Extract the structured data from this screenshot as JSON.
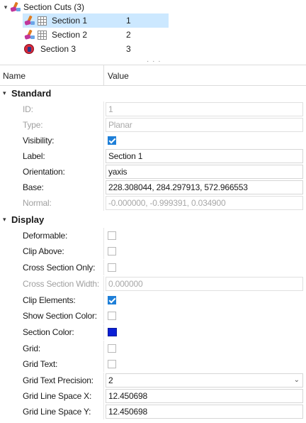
{
  "tree": {
    "parent_label": "Section Cuts (3)",
    "items": [
      {
        "label": "Section 1",
        "id": "1"
      },
      {
        "label": "Section 2",
        "id": "2"
      },
      {
        "label": "Section 3",
        "id": "3"
      }
    ],
    "splitter": "· · ·"
  },
  "grid_header": {
    "name": "Name",
    "value": "Value"
  },
  "standard": {
    "title": "Standard",
    "id_label": "ID:",
    "id_value": "1",
    "type_label": "Type:",
    "type_value": "Planar",
    "visibility_label": "Visibility:",
    "visibility_checked": true,
    "label_label": "Label:",
    "label_value": "Section 1",
    "orientation_label": "Orientation:",
    "orientation_value": "yaxis",
    "base_label": "Base:",
    "base_value": "228.308044, 284.297913, 572.966553",
    "normal_label": "Normal:",
    "normal_value": "-0.000000, -0.999391, 0.034900"
  },
  "display": {
    "title": "Display",
    "deformable_label": "Deformable:",
    "deformable_checked": false,
    "clip_above_label": "Clip Above:",
    "clip_above_checked": false,
    "cross_section_only_label": "Cross Section Only:",
    "cross_section_only_checked": false,
    "cross_section_width_label": "Cross Section Width:",
    "cross_section_width_value": "0.000000",
    "clip_elements_label": "Clip Elements:",
    "clip_elements_checked": true,
    "show_section_color_label": "Show Section Color:",
    "show_section_color_checked": false,
    "section_color_label": "Section Color:",
    "section_color": "#0a1fd6",
    "grid_label": "Grid:",
    "grid_checked": false,
    "grid_text_label": "Grid Text:",
    "grid_text_checked": false,
    "grid_text_precision_label": "Grid Text Precision:",
    "grid_text_precision_value": "2",
    "grid_line_space_x_label": "Grid Line Space X:",
    "grid_line_space_x_value": "12.450698",
    "grid_line_space_y_label": "Grid Line Space Y:",
    "grid_line_space_y_value": "12.450698"
  },
  "icons": {
    "expand": "chevron-down-icon",
    "section_cut": "section-cut-icon",
    "grid": "grid-icon",
    "section_circle": "section-circle-icon"
  }
}
